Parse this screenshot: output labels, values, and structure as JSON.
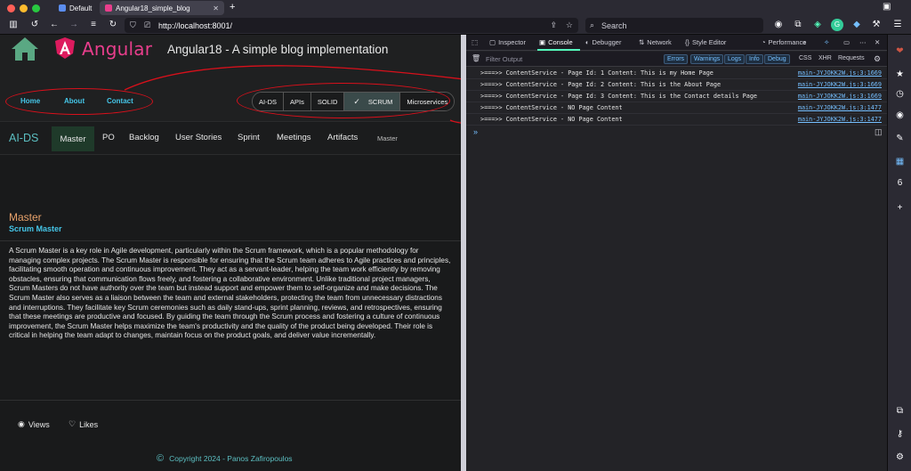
{
  "browser": {
    "tabs": [
      {
        "label": "Default",
        "active": false
      },
      {
        "label": "Angular18_simple_blog",
        "active": true
      }
    ],
    "new_tab_icon": "plus-icon",
    "url": "http://localhost:8001/",
    "search_placeholder": "Search"
  },
  "header": {
    "home_icon": "house-icon",
    "logo_text": "Angular",
    "title": "Angular18 - A simple blog implementation",
    "nav": [
      "Home",
      "About",
      "Contact"
    ],
    "pills": [
      {
        "label": "AI-DS",
        "active": false
      },
      {
        "label": "APIs",
        "active": false
      },
      {
        "label": "SOLID",
        "active": false
      },
      {
        "label": "SCRUM",
        "active": true
      },
      {
        "label": "Microservices",
        "active": false
      }
    ]
  },
  "subnav": {
    "brand": "AI-DS",
    "items": [
      "Master",
      "PO",
      "Backlog",
      "User Stories",
      "Sprint",
      "Meetings",
      "Artifacts"
    ],
    "crumb": "Master"
  },
  "content": {
    "title": "Master",
    "subtitle": "Scrum Master",
    "body": "A Scrum Master is a key role in Agile development, particularly within the Scrum framework, which is a popular methodology for managing complex projects. The Scrum Master is responsible for ensuring that the Scrum team adheres to Agile practices and principles, facilitating smooth operation and continuous improvement. They act as a servant-leader, helping the team work efficiently by removing obstacles, ensuring that communication flows freely, and fostering a collaborative environment. Unlike traditional project managers, Scrum Masters do not have authority over the team but instead support and empower them to self-organize and make decisions. The Scrum Master also serves as a liaison between the team and external stakeholders, protecting the team from unnecessary distractions and interruptions. They facilitate key Scrum ceremonies such as daily stand-ups, sprint planning, reviews, and retrospectives, ensuring that these meetings are productive and focused. By guiding the team through the Scrum process and fostering a culture of continuous improvement, the Scrum Master helps maximize the team's productivity and the quality of the product being developed. Their role is critical in helping the team adapt to changes, maintain focus on the product goals, and deliver value incrementally."
  },
  "footer": {
    "views": "Views",
    "likes": "Likes",
    "copyright": "Copyright 2024 - Panos Zafiropoulos"
  },
  "devtools": {
    "tabs": [
      "Inspector",
      "Console",
      "Debugger",
      "Network",
      "Style Editor",
      "Performance"
    ],
    "filter_placeholder": "Filter Output",
    "filters": [
      "Errors",
      "Warnings",
      "Logs",
      "Info",
      "Debug"
    ],
    "extra": [
      "CSS",
      "XHR",
      "Requests"
    ],
    "logs": [
      {
        "msg": ">===>> ContentService - Page Id: 1 Content: This is my Home Page",
        "src": "main-JYJOKK2W.js:3:1669"
      },
      {
        "msg": ">===>> ContentService - Page Id: 2 Content: This is the About Page",
        "src": "main-JYJOKK2W.js:3:1669"
      },
      {
        "msg": ">===>> ContentService - Page Id: 3 Content: This is the Contact details Page",
        "src": "main-JYJOKK2W.js:3:1669"
      },
      {
        "msg": ">===>> ContentService - NO Page Content",
        "src": "main-JYJOKK2W.js:3:1477"
      },
      {
        "msg": ">===>> ContentService - NO Page Content",
        "src": "main-JYJOKK2W.js:3:1477"
      }
    ],
    "prompt": "»"
  }
}
